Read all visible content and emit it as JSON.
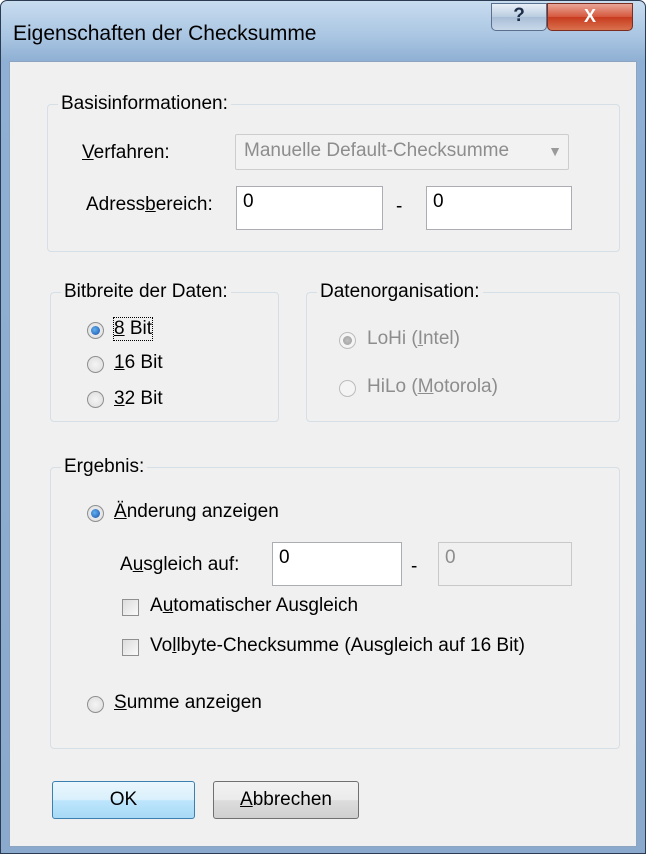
{
  "window": {
    "title": "Eigenschaften der Checksumme",
    "help_label": "?",
    "close_label": "X"
  },
  "basis": {
    "title": "Basisinformationen:",
    "verfahren_label_pre": "",
    "verfahren_label_key": "V",
    "verfahren_label_post": "erfahren:",
    "verfahren_value": "Manuelle Default-Checksumme",
    "adress_label_pre": "Adress",
    "adress_label_key": "b",
    "adress_label_post": "ereich:",
    "adress_from": "0",
    "adress_sep": "-",
    "adress_to": "0"
  },
  "bitbreite": {
    "title": "Bitbreite der Daten:",
    "options": [
      {
        "key": "8",
        "rest": " Bit",
        "selected": true
      },
      {
        "key": "1",
        "rest": "6 Bit",
        "selected": false
      },
      {
        "key": "3",
        "rest": "2 Bit",
        "selected": false
      }
    ]
  },
  "datenorg": {
    "title": "Datenorganisation:",
    "opt1_pre": "LoHi (",
    "opt1_key": "I",
    "opt1_post": "ntel)",
    "opt2_pre": "HiLo (",
    "opt2_key": "M",
    "opt2_post": "otorola)"
  },
  "ergebnis": {
    "title": "Ergebnis:",
    "aenderung_key": "Ä",
    "aenderung_rest": "nderung anzeigen",
    "ausgleich_pre": "A",
    "ausgleich_key": "u",
    "ausgleich_post": "sgleich auf:",
    "ausgleich_from": "0",
    "ausgleich_sep": "-",
    "ausgleich_to": "0",
    "auto_pre": "A",
    "auto_key": "u",
    "auto_post": "tomatischer Ausgleich",
    "vollbyte_pre": "Vo",
    "vollbyte_key": "l",
    "vollbyte_post": "lbyte-Checksumme (Ausgleich auf 16 Bit)",
    "summe_key": "S",
    "summe_rest": "umme anzeigen"
  },
  "buttons": {
    "ok_label": "OK",
    "cancel_key": "A",
    "cancel_rest": "bbrechen"
  }
}
